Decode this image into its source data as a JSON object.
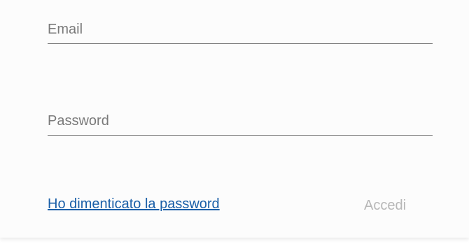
{
  "login_form": {
    "email_placeholder": "Email",
    "email_value": "",
    "password_placeholder": "Password",
    "password_value": "",
    "forgot_password_label": "Ho dimenticato la password",
    "submit_label": "Accedi",
    "submit_disabled": true
  },
  "colors": {
    "link": "#1a5fa8",
    "disabled_text": "#b7b7b7",
    "underline": "#6f6f6f"
  }
}
